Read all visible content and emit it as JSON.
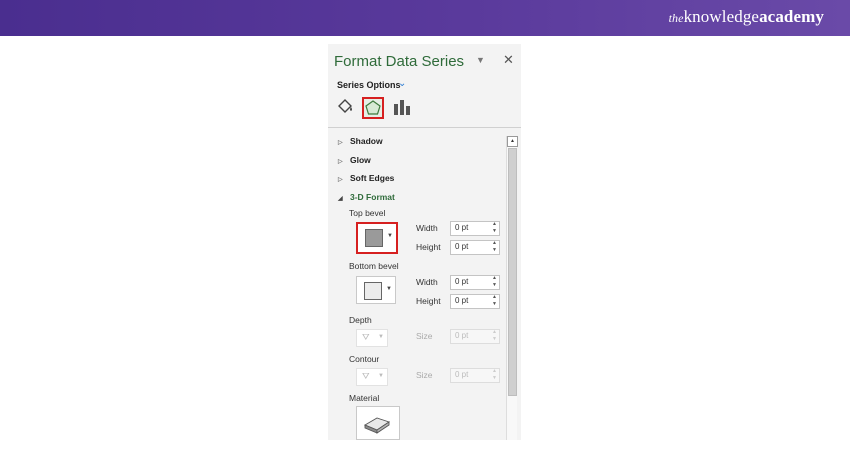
{
  "brand": {
    "prefix": "the",
    "mid": "knowledge",
    "strong": "academy"
  },
  "pane": {
    "title": "Format Data Series",
    "options_label": "Series Options",
    "tabs": {
      "fill_icon": "paint-bucket-icon",
      "effects_icon": "pentagon-icon",
      "series_icon": "bar-chart-icon",
      "selected": "effects"
    },
    "sections": {
      "shadow": "Shadow",
      "glow": "Glow",
      "soft_edges": "Soft Edges",
      "format_3d": "3-D Format"
    },
    "top_bevel": {
      "label": "Top bevel",
      "width_label": "Width",
      "width_value": "0 pt",
      "height_label": "Height",
      "height_value": "0 pt"
    },
    "bottom_bevel": {
      "label": "Bottom bevel",
      "width_label": "Width",
      "width_value": "0 pt",
      "height_label": "Height",
      "height_value": "0 pt"
    },
    "depth": {
      "label": "Depth",
      "size_label": "Size",
      "size_value": "0 pt"
    },
    "contour": {
      "label": "Contour",
      "size_label": "Size",
      "size_value": "0 pt"
    },
    "material": {
      "label": "Material"
    }
  },
  "colors": {
    "accent_red": "#d62020",
    "title_green": "#2f6b3a",
    "banner": "#4a2e8f"
  }
}
